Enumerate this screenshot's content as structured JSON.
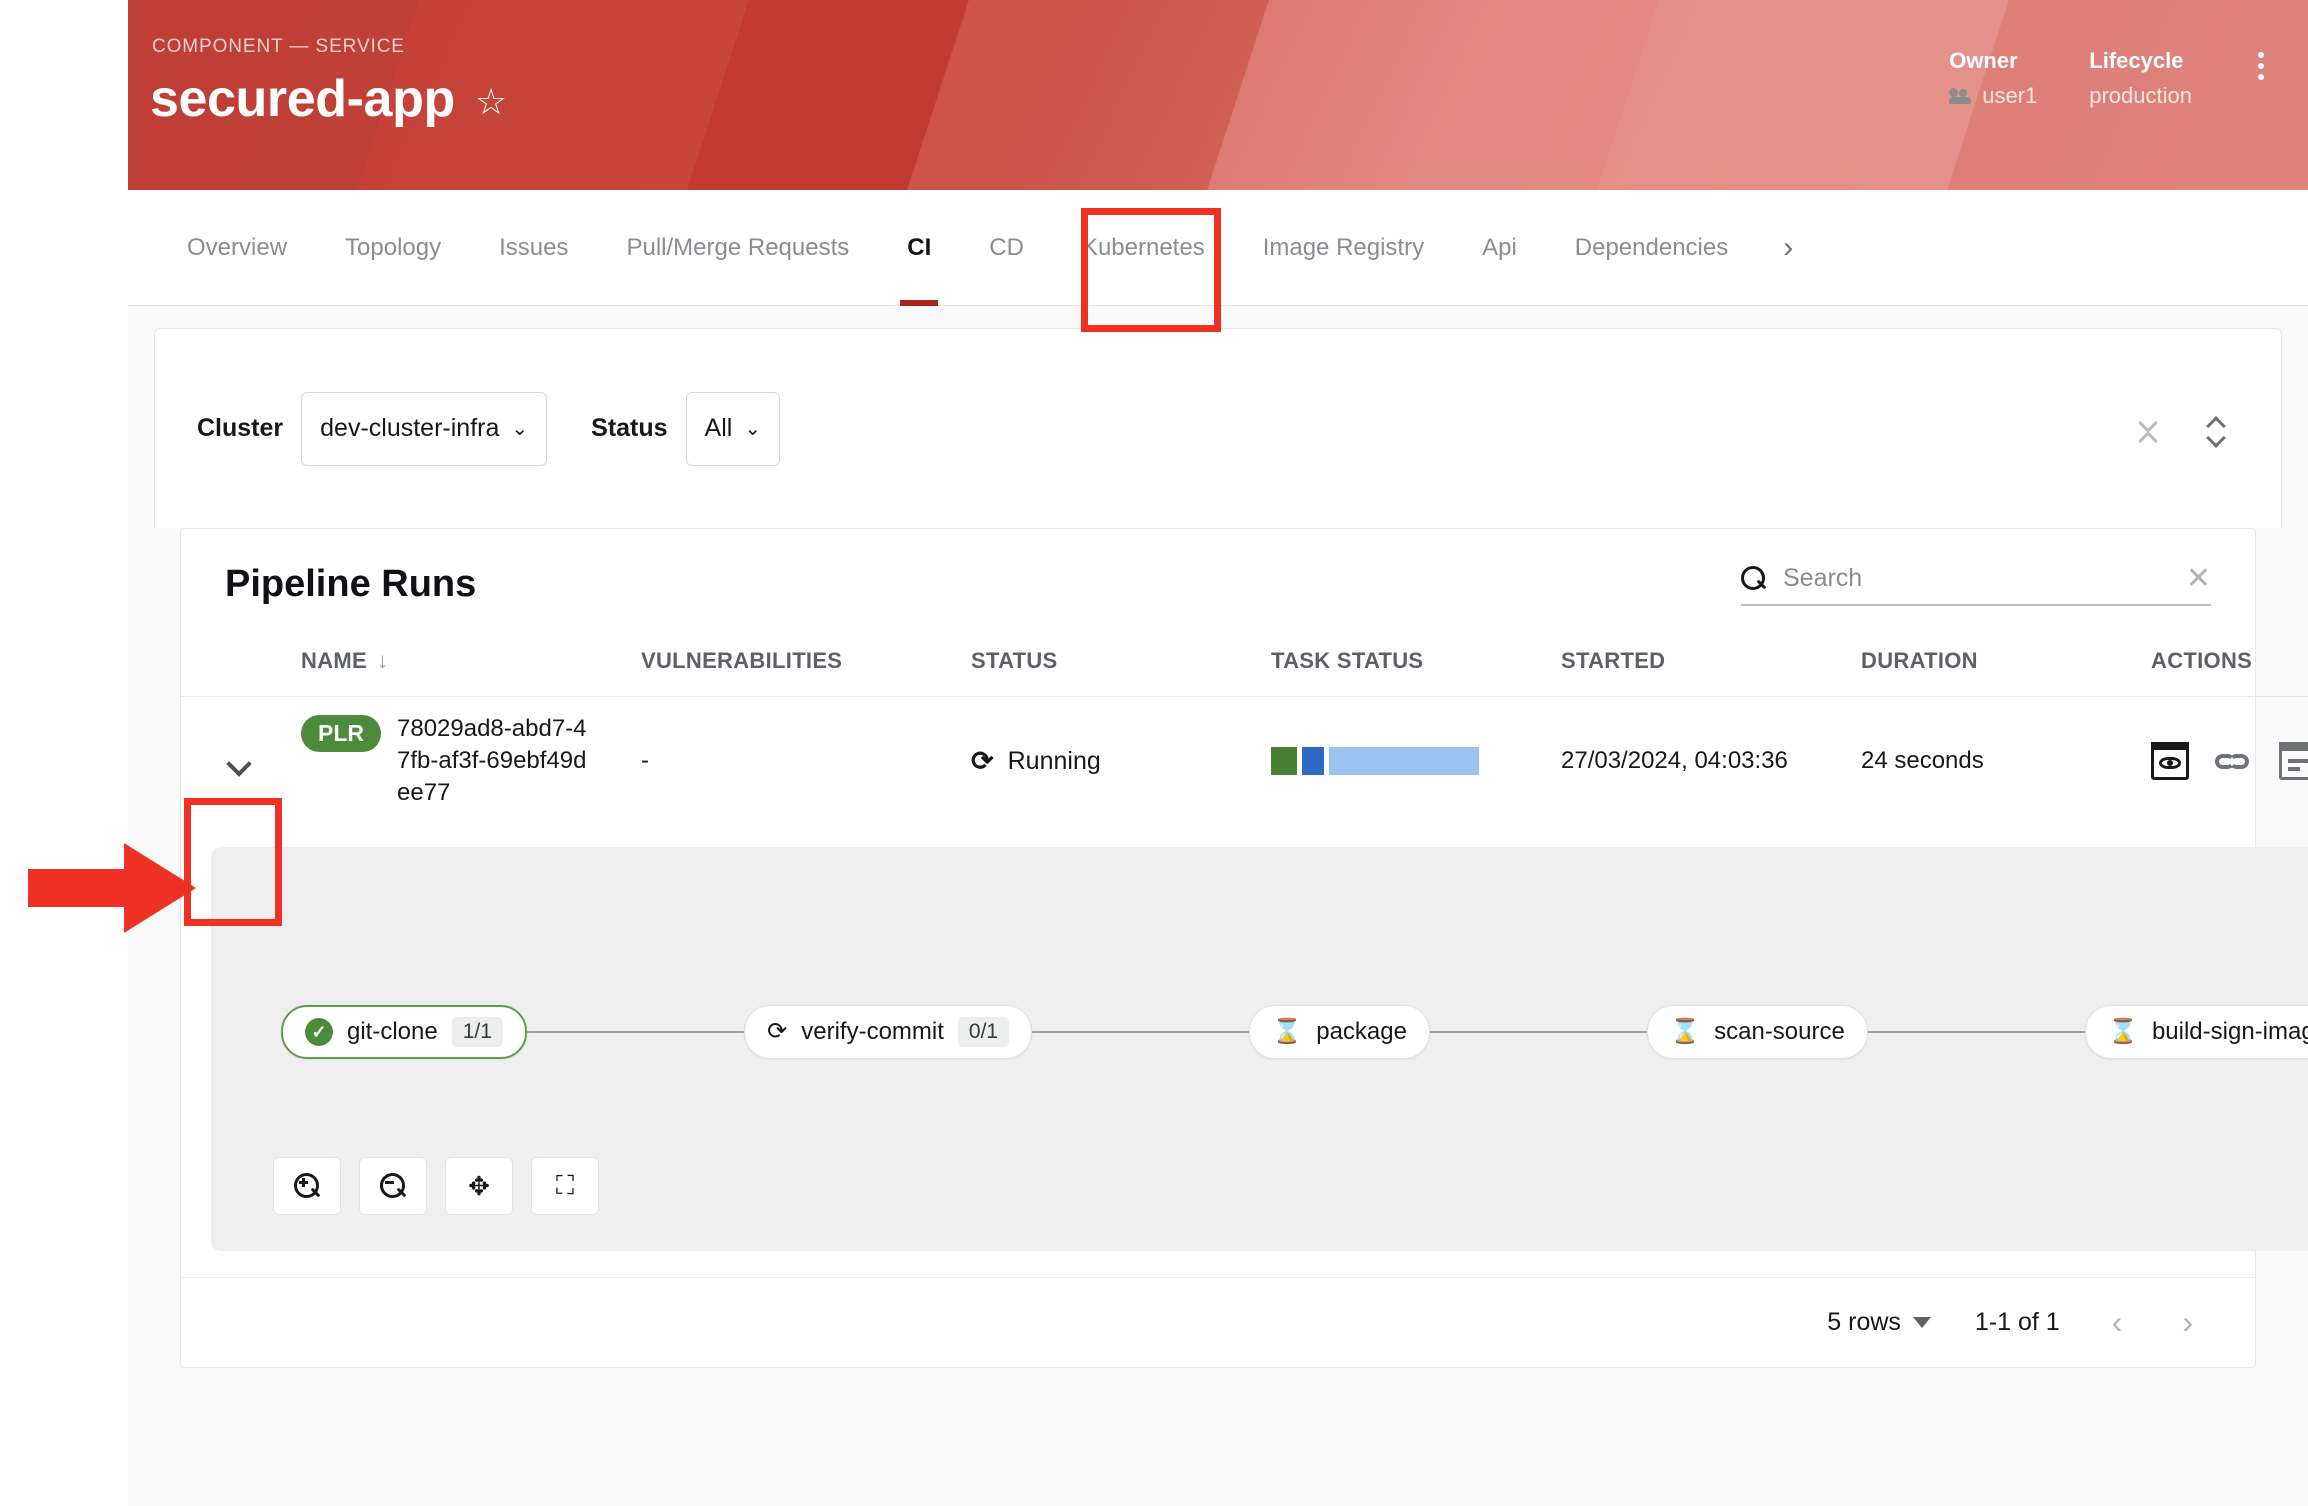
{
  "header": {
    "eyebrow": "COMPONENT — SERVICE",
    "title": "secured-app",
    "star_icon": "star-outline-icon",
    "owner_label": "Owner",
    "owner_value": "user1",
    "lifecycle_label": "Lifecycle",
    "lifecycle_value": "production",
    "menu_icon": "kebab-menu-icon",
    "accent_color": "#c9453c"
  },
  "tabs": {
    "items": [
      {
        "label": "Overview",
        "active": false
      },
      {
        "label": "Topology",
        "active": false
      },
      {
        "label": "Issues",
        "active": false
      },
      {
        "label": "Pull/Merge Requests",
        "active": false
      },
      {
        "label": "CI",
        "active": true
      },
      {
        "label": "CD",
        "active": false
      },
      {
        "label": "Kubernetes",
        "active": false
      },
      {
        "label": "Image Registry",
        "active": false
      },
      {
        "label": "Api",
        "active": false
      },
      {
        "label": "Dependencies",
        "active": false
      }
    ],
    "overflow_icon": "chevron-right-icon",
    "active_underline_color": "#a9251b"
  },
  "filters": {
    "cluster_label": "Cluster",
    "cluster_value": "dev-cluster-infra",
    "status_label": "Status",
    "status_value": "All",
    "collapse_all_icon": "collapse-all-icon",
    "expand_all_icon": "expand-all-icon"
  },
  "table": {
    "title": "Pipeline Runs",
    "search_placeholder": "Search",
    "search_value": "",
    "search_icon": "search-icon",
    "clear_icon": "close-icon",
    "columns": [
      "NAME",
      "VULNERABILITIES",
      "STATUS",
      "TASK STATUS",
      "STARTED",
      "DURATION",
      "ACTIONS"
    ],
    "sort_column": "NAME",
    "sort_direction_icon": "arrow-down-icon",
    "rows": [
      {
        "expanded": true,
        "badge": "PLR",
        "badge_color": "#4c8b3a",
        "name": "78029ad8-abd7-47fb-af3f-69ebf49dee77",
        "vulnerabilities": "-",
        "status": "Running",
        "status_icon": "sync-icon",
        "task_status": {
          "succeeded": 1,
          "running": 1,
          "pending": 6,
          "colors": {
            "succeeded": "#4a7f36",
            "running": "#2d68c4",
            "pending": "#9cc3f0"
          }
        },
        "started": "27/03/2024, 04:03:36",
        "duration": "24 seconds",
        "actions": [
          "view-icon",
          "link-icon",
          "logs-icon"
        ]
      }
    ]
  },
  "pipeline_graph": {
    "nodes": [
      {
        "label": "git-clone",
        "count": "1/1",
        "state": "succeeded",
        "icon": "check-circle-icon"
      },
      {
        "label": "verify-commit",
        "count": "0/1",
        "state": "running",
        "icon": "sync-icon"
      },
      {
        "label": "package",
        "count": "",
        "state": "pending",
        "icon": "hourglass-icon"
      },
      {
        "label": "scan-source",
        "count": "",
        "state": "pending",
        "icon": "hourglass-icon"
      },
      {
        "label": "build-sign-image",
        "count": "",
        "state": "pending",
        "icon": "hourglass-icon"
      }
    ],
    "controls": [
      {
        "name": "zoom-in-button",
        "icon": "zoom-in-icon"
      },
      {
        "name": "zoom-out-button",
        "icon": "zoom-out-icon"
      },
      {
        "name": "fit-to-screen-button",
        "icon": "fit-screen-icon"
      },
      {
        "name": "fullscreen-button",
        "icon": "fullscreen-icon"
      }
    ]
  },
  "pagination": {
    "rows_per_page": "5 rows",
    "range": "1-1 of 1",
    "prev_icon": "chevron-left-icon",
    "next_icon": "chevron-right-icon"
  },
  "annotations": {
    "arrow_color": "#ef3124",
    "highlight_color": "#ef3124"
  }
}
